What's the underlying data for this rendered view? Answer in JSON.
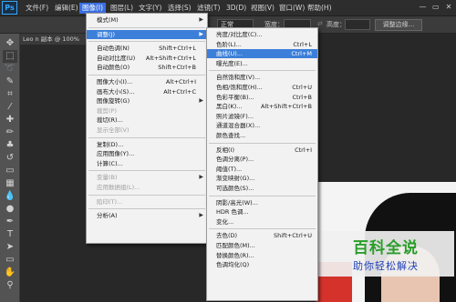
{
  "app": {
    "logo": "Ps"
  },
  "menubar": {
    "items": [
      {
        "label": "文件(F)"
      },
      {
        "label": "编辑(E)"
      },
      {
        "label": "图像(I)"
      },
      {
        "label": "图层(L)"
      },
      {
        "label": "文字(Y)"
      },
      {
        "label": "选择(S)"
      },
      {
        "label": "滤镜(T)"
      },
      {
        "label": "3D(D)"
      },
      {
        "label": "视图(V)"
      },
      {
        "label": "窗口(W)"
      },
      {
        "label": "帮助(H)"
      }
    ],
    "active_index": 2,
    "window_controls": {
      "minimize": "—",
      "restore": "▭",
      "close": "✕"
    }
  },
  "options_bar": {
    "style_value": "正常",
    "width_label": "宽度：",
    "height_label": "高度：",
    "adjust_edge_button": "调整边缘..."
  },
  "document": {
    "tab_title": "Leo n 副本 @ 100%"
  },
  "image_menu": {
    "items": [
      {
        "label": "模式(M)",
        "submenu": true
      },
      {
        "sep": true
      },
      {
        "label": "调整(J)",
        "submenu": true,
        "highlighted": true
      },
      {
        "sep": true
      },
      {
        "label": "自动色调(N)",
        "shortcut": "Shift+Ctrl+L"
      },
      {
        "label": "自动对比度(U)",
        "shortcut": "Alt+Shift+Ctrl+L"
      },
      {
        "label": "自动颜色(O)",
        "shortcut": "Shift+Ctrl+B"
      },
      {
        "sep": true
      },
      {
        "label": "图像大小(I)...",
        "shortcut": "Alt+Ctrl+I"
      },
      {
        "label": "画布大小(S)...",
        "shortcut": "Alt+Ctrl+C"
      },
      {
        "label": "图像旋转(G)",
        "submenu": true
      },
      {
        "label": "裁剪(P)",
        "disabled": true
      },
      {
        "label": "裁切(R)..."
      },
      {
        "label": "显示全部(V)",
        "disabled": true
      },
      {
        "sep": true
      },
      {
        "label": "复制(D)..."
      },
      {
        "label": "应用图像(Y)..."
      },
      {
        "label": "计算(C)..."
      },
      {
        "sep": true
      },
      {
        "label": "变量(B)",
        "submenu": true,
        "disabled": true
      },
      {
        "label": "应用数据组(L)...",
        "disabled": true
      },
      {
        "sep": true
      },
      {
        "label": "陷印(T)...",
        "disabled": true
      },
      {
        "sep": true
      },
      {
        "label": "分析(A)",
        "submenu": true
      }
    ]
  },
  "adjust_menu": {
    "items": [
      {
        "label": "亮度/对比度(C)..."
      },
      {
        "label": "色阶(L)...",
        "shortcut": "Ctrl+L"
      },
      {
        "label": "曲线(U)...",
        "shortcut": "Ctrl+M",
        "highlighted": true
      },
      {
        "label": "曝光度(E)..."
      },
      {
        "sep": true
      },
      {
        "label": "自然饱和度(V)..."
      },
      {
        "label": "色相/饱和度(H)...",
        "shortcut": "Ctrl+U"
      },
      {
        "label": "色彩平衡(B)...",
        "shortcut": "Ctrl+B"
      },
      {
        "label": "黑白(K)...",
        "shortcut": "Alt+Shift+Ctrl+B"
      },
      {
        "label": "照片滤镜(F)..."
      },
      {
        "label": "通道混合器(X)..."
      },
      {
        "label": "颜色查找..."
      },
      {
        "sep": true
      },
      {
        "label": "反相(I)",
        "shortcut": "Ctrl+I"
      },
      {
        "label": "色调分离(P)..."
      },
      {
        "label": "阈值(T)..."
      },
      {
        "label": "渐变映射(G)..."
      },
      {
        "label": "可选颜色(S)..."
      },
      {
        "sep": true
      },
      {
        "label": "阴影/高光(W)..."
      },
      {
        "label": "HDR 色调..."
      },
      {
        "label": "变化..."
      },
      {
        "sep": true
      },
      {
        "label": "去色(D)",
        "shortcut": "Shift+Ctrl+U"
      },
      {
        "label": "匹配颜色(M)..."
      },
      {
        "label": "替换颜色(R)..."
      },
      {
        "label": "色调均化(Q)"
      }
    ]
  },
  "toolbar": {
    "tools": [
      {
        "name": "move-tool-icon",
        "glyph": "✥"
      },
      {
        "name": "marquee-tool-icon",
        "glyph": "⬚"
      },
      {
        "name": "lasso-tool-icon",
        "glyph": "➰"
      },
      {
        "name": "quick-select-tool-icon",
        "glyph": "✎"
      },
      {
        "name": "crop-tool-icon",
        "glyph": "⌗"
      },
      {
        "name": "eyedropper-tool-icon",
        "glyph": "⁄"
      },
      {
        "name": "healing-brush-tool-icon",
        "glyph": "✚"
      },
      {
        "name": "brush-tool-icon",
        "glyph": "✏"
      },
      {
        "name": "clone-stamp-tool-icon",
        "glyph": "♣"
      },
      {
        "name": "history-brush-tool-icon",
        "glyph": "↺"
      },
      {
        "name": "eraser-tool-icon",
        "glyph": "▭"
      },
      {
        "name": "gradient-tool-icon",
        "glyph": "▦"
      },
      {
        "name": "blur-tool-icon",
        "glyph": "💧"
      },
      {
        "name": "dodge-tool-icon",
        "glyph": "●"
      },
      {
        "name": "pen-tool-icon",
        "glyph": "✒"
      },
      {
        "name": "type-tool-icon",
        "glyph": "T"
      },
      {
        "name": "path-selection-tool-icon",
        "glyph": "➤"
      },
      {
        "name": "shape-tool-icon",
        "glyph": "▭"
      },
      {
        "name": "hand-tool-icon",
        "glyph": "✋"
      },
      {
        "name": "zoom-tool-icon",
        "glyph": "⚲"
      }
    ]
  },
  "watermark": {
    "title": "百科全说",
    "subtitle": "助你轻松解决"
  },
  "colors": {
    "accent": "#3c7fd9",
    "menubar": "#2d2d2d",
    "toolbar": "#535353",
    "workspace": "#282828"
  }
}
